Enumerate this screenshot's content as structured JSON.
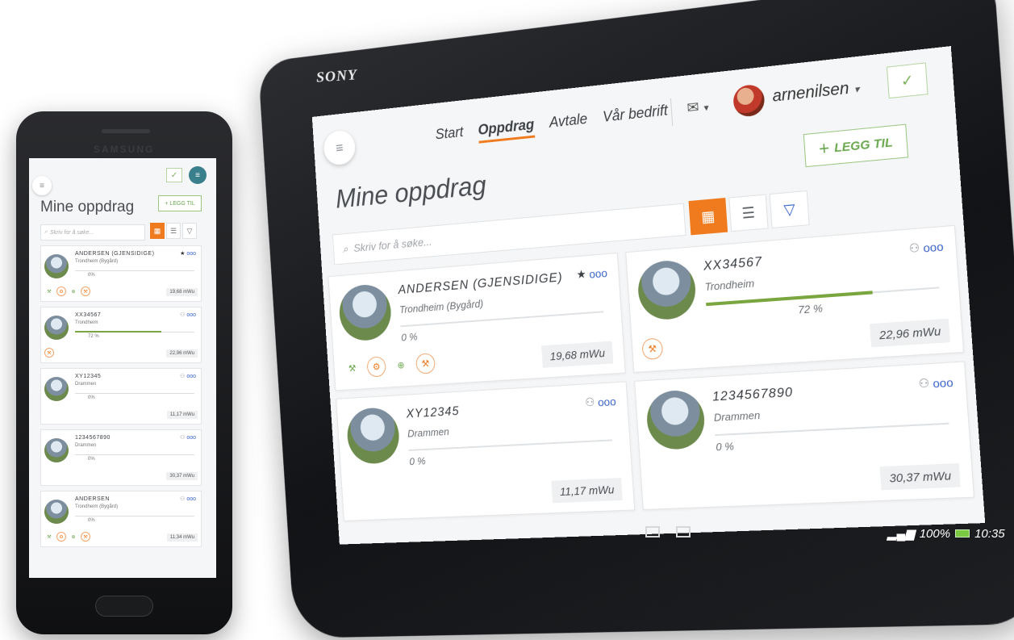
{
  "tablet": {
    "brand": "SONY",
    "nav": {
      "menu_icon": "hamburger-icon",
      "links": [
        {
          "label": "Start",
          "active": false
        },
        {
          "label": "Oppdrag",
          "active": true
        },
        {
          "label": "Avtale",
          "active": false
        },
        {
          "label": "Vår bedrift",
          "active": false
        }
      ],
      "mail_icon": "mail-icon",
      "username": "arnenilsen",
      "check_icon": "check-icon"
    },
    "page_title": "Mine oppdrag",
    "add_button": "LEGG TIL",
    "search_placeholder": "Skriv for å søke...",
    "views": [
      "grid-view",
      "list-view",
      "filter"
    ],
    "cards": [
      {
        "name": "ANDERSEN (GJENSIDIGE)",
        "location": "Trondheim (Bygård)",
        "percent": "0 %",
        "progress": 0,
        "amount": "19,68 mWu",
        "starred": true
      },
      {
        "name": "XX34567",
        "location": "Trondheim",
        "percent": "72 %",
        "progress": 0.72,
        "amount": "22,96 mWu",
        "starred": false
      },
      {
        "name": "XY12345",
        "location": "Drammen",
        "percent": "0 %",
        "progress": 0,
        "amount": "11,17 mWu",
        "starred": false
      },
      {
        "name": "1234567890",
        "location": "Drammen",
        "percent": "0 %",
        "progress": 0,
        "amount": "30,37 mWu",
        "starred": false
      }
    ],
    "status": {
      "signal": "100%",
      "time": "10:35"
    }
  },
  "phone": {
    "brand": "SAMSUNG",
    "page_title": "Mine oppdrag",
    "add_button": "LEGG TIL",
    "search_placeholder": "Skriv for å søke...",
    "cards": [
      {
        "name": "ANDERSEN (GJENSIDIGE)",
        "location": "Trondheim (Bygård)",
        "percent": "0%",
        "progress": 0,
        "amount": "19,68 mWu"
      },
      {
        "name": "XX34567",
        "location": "Trondheim",
        "percent": "72 %",
        "progress": 0.72,
        "amount": "22,96 mWu"
      },
      {
        "name": "XY12345",
        "location": "Drammen",
        "percent": "0%",
        "progress": 0,
        "amount": "11,17 mWu"
      },
      {
        "name": "1234567890",
        "location": "Drammen",
        "percent": "0%",
        "progress": 0,
        "amount": "30,37 mWu"
      },
      {
        "name": "ANDERSEN",
        "location": "Trondheim (Bygård)",
        "percent": "0%",
        "progress": 0,
        "amount": "11,34 mWu"
      }
    ]
  }
}
